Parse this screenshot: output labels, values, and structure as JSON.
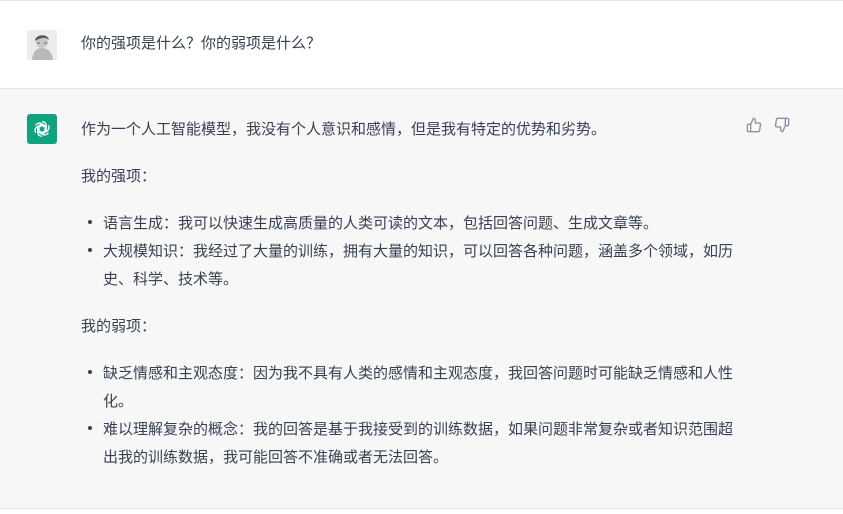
{
  "user_message": {
    "text": "你的强项是什么？你的弱项是什么？"
  },
  "assistant_message": {
    "intro": "作为一个人工智能模型，我没有个人意识和感情，但是我有特定的优势和劣势。",
    "strengths_heading": "我的强项：",
    "strengths": [
      "语言生成：我可以快速生成高质量的人类可读的文本，包括回答问题、生成文章等。",
      "大规模知识：我经过了大量的训练，拥有大量的知识，可以回答各种问题，涵盖多个领域，如历史、科学、技术等。"
    ],
    "weaknesses_heading": "我的弱项：",
    "weaknesses": [
      "缺乏情感和主观态度：因为我不具有人类的感情和主观态度，我回答问题时可能缺乏情感和人性化。",
      "难以理解复杂的概念：我的回答是基于我接受到的训练数据，如果问题非常复杂或者知识范围超出我的训练数据，我可能回答不准确或者无法回答。"
    ]
  },
  "icons": {
    "user_avatar": "user-avatar-photo",
    "assistant_avatar": "openai-logo-icon",
    "thumbs_up": "thumbs-up-icon",
    "thumbs_down": "thumbs-down-icon"
  },
  "colors": {
    "assistant_bg": "#f7f7f8",
    "brand_green": "#10a37f",
    "text": "#374151",
    "icon_gray": "#8e8ea0"
  }
}
